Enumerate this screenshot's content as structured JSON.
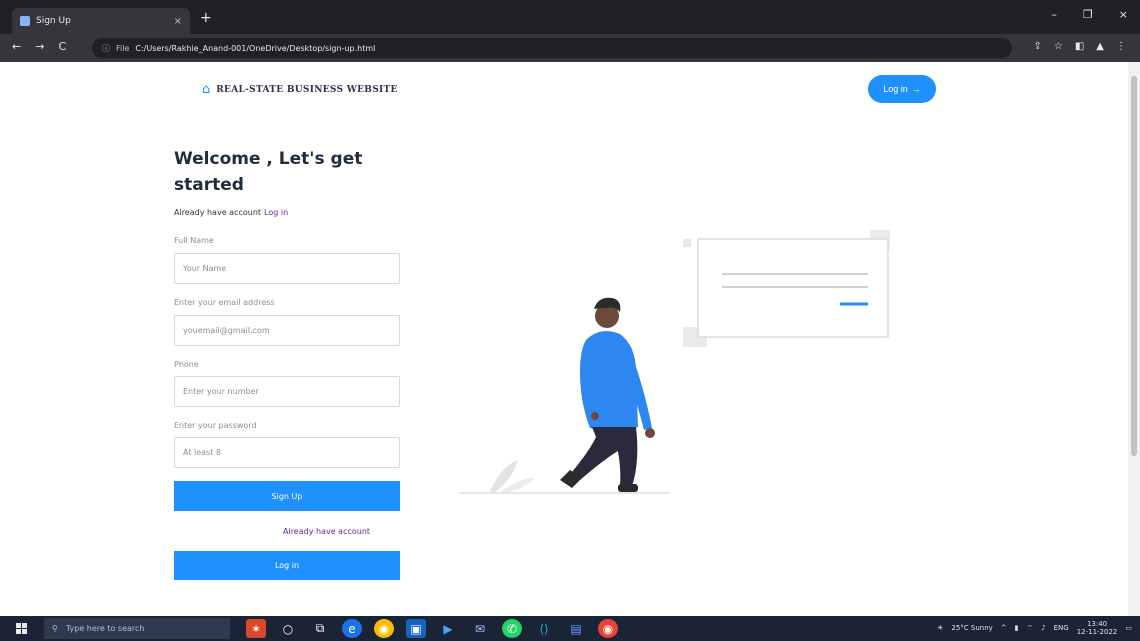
{
  "browser": {
    "tab_title": "Sign Up",
    "tab_close": "×",
    "new_tab": "+",
    "window_controls": [
      "–",
      "❐",
      "×"
    ],
    "nav": [
      "←",
      "→",
      "C"
    ],
    "address_prefix": "File",
    "url": "C:/Users/Rakhie_Anand-001/OneDrive/Desktop/sign-up.html",
    "toolbar_icons": [
      "⇪",
      "☆",
      "◧",
      "▲",
      "⋮"
    ]
  },
  "header": {
    "brand_icon": "house-icon",
    "brand_name": "REAL-STATE BUSINESS WEBSITE",
    "login_button": "Log in"
  },
  "form": {
    "welcome_line1": "Welcome , Let's get",
    "welcome_line2": "started",
    "already_text": "Already have account",
    "already_link": "Log in",
    "fields": [
      {
        "label": "Full Name",
        "placeholder": "Your Name"
      },
      {
        "label": "Enter your email address",
        "placeholder": "youemail@gmail.com"
      },
      {
        "label": "Phone",
        "placeholder": "Enter your number"
      },
      {
        "label": "Enter your password",
        "placeholder": "At least 8"
      }
    ],
    "signup_button": "Sign Up",
    "already_account": "Already have account",
    "login_button": "Log in"
  },
  "taskbar": {
    "search_placeholder": "Type here to search",
    "weather": "25°C Sunny",
    "lang": "ENG",
    "time": "13:40",
    "date": "12-11-2022"
  },
  "colors": {
    "accent": "#1e90ff",
    "link": "#6b21a8",
    "heading": "#1f2d3d"
  }
}
